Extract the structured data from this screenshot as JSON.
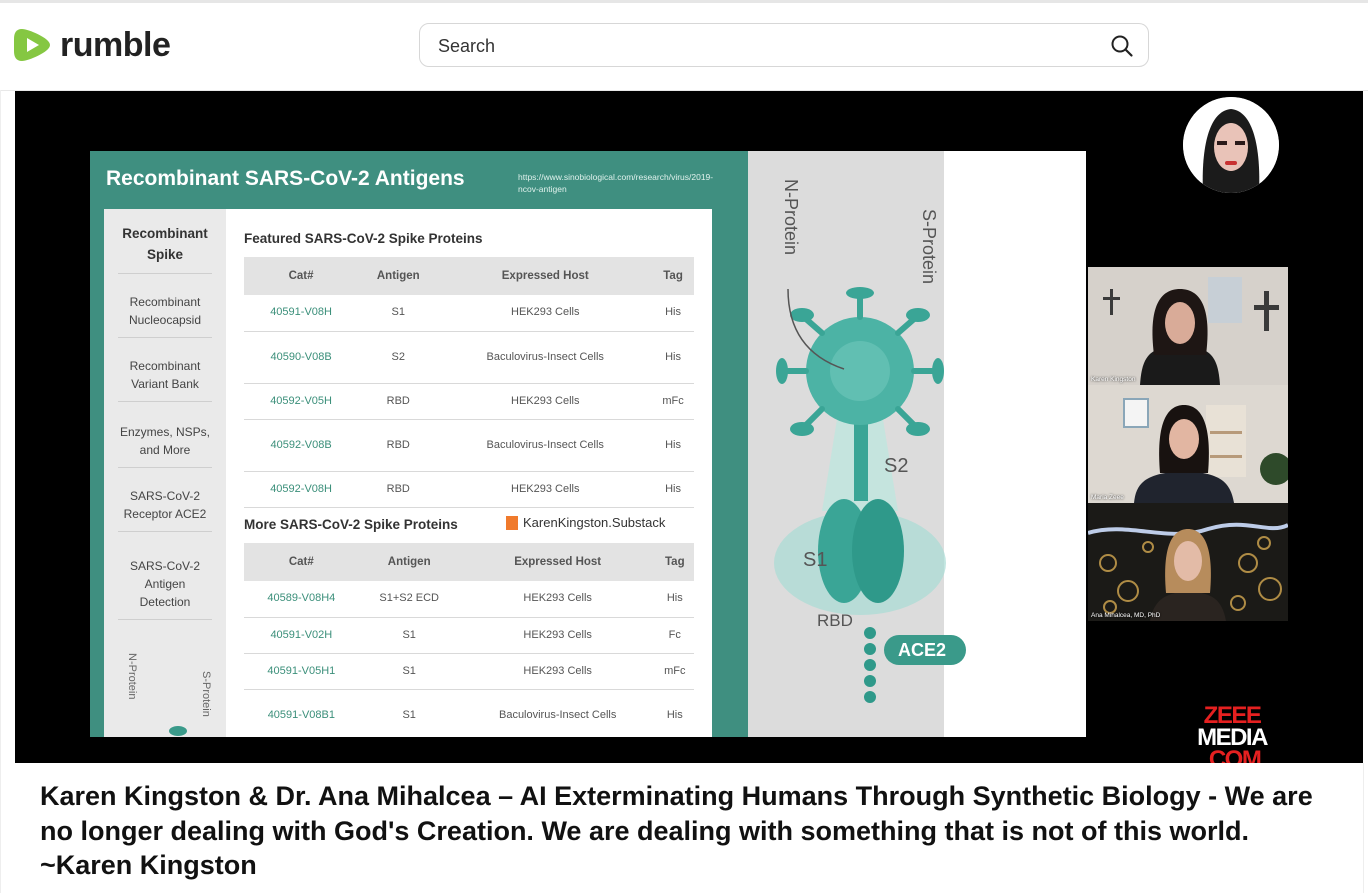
{
  "header": {
    "logo_text": "rumble",
    "logo_color": "#85c742",
    "search_placeholder": "Search"
  },
  "slide": {
    "title": "Recombinant SARS-CoV-2 Antigens",
    "url": "https://www.sinobiological.com/research/virus/2019-ncov-antigen",
    "nav_items": [
      "Recombinant Spike",
      "Recombinant Nucleocapsid",
      "Recombinant Variant Bank",
      "Enzymes, NSPs, and More",
      "SARS-CoV-2 Receptor ACE2",
      "SARS-CoV-2 Antigen Detection"
    ],
    "nav_vert_left": "N-Protein",
    "nav_vert_right": "S-Protein",
    "columns": [
      "Cat#",
      "Antigen",
      "Expressed Host",
      "Tag"
    ],
    "featured_title": "Featured SARS-CoV-2 Spike Proteins",
    "featured_rows": [
      {
        "cat": "40591-V08H",
        "antigen": "S1",
        "host": "HEK293 Cells",
        "tag": "His"
      },
      {
        "cat": "40590-V08B",
        "antigen": "S2",
        "host": "Baculovirus-Insect Cells",
        "tag": "His"
      },
      {
        "cat": "40592-V05H",
        "antigen": "RBD",
        "host": "HEK293 Cells",
        "tag": "mFc"
      },
      {
        "cat": "40592-V08B",
        "antigen": "RBD",
        "host": "Baculovirus-Insect Cells",
        "tag": "His"
      },
      {
        "cat": "40592-V08H",
        "antigen": "RBD",
        "host": "HEK293 Cells",
        "tag": "His"
      }
    ],
    "more_title": "More SARS-CoV-2 Spike Proteins",
    "substack": "KarenKingston.Substack",
    "more_rows": [
      {
        "cat": "40589-V08H4",
        "antigen": "S1+S2 ECD",
        "host": "HEK293 Cells",
        "tag": "His"
      },
      {
        "cat": "40591-V02H",
        "antigen": "S1",
        "host": "HEK293 Cells",
        "tag": "Fc"
      },
      {
        "cat": "40591-V05H1",
        "antigen": "S1",
        "host": "HEK293 Cells",
        "tag": "mFc"
      },
      {
        "cat": "40591-V08B1",
        "antigen": "S1",
        "host": "Baculovirus-Insect Cells",
        "tag": "His"
      }
    ],
    "diagram": {
      "n_protein": "N-Protein",
      "s_protein": "S-Protein",
      "s2": "S2",
      "s1": "S1",
      "rbd": "RBD",
      "ace2": "ACE2"
    }
  },
  "participants": [
    {
      "name": "Karen Kingston"
    },
    {
      "name": "Maria Zeee"
    },
    {
      "name": "Ana Mihalcea, MD, PhD"
    }
  ],
  "brand": {
    "line1": "ZEEE",
    "line2": "MEDIA",
    "line3": ".COM"
  },
  "video": {
    "title": "Karen Kingston & Dr. Ana Mihalcea – AI Exterminating Humans Through Synthetic Biology - We are no longer dealing with God's Creation. We are dealing with something that is not of this world. ~Karen Kingston"
  }
}
